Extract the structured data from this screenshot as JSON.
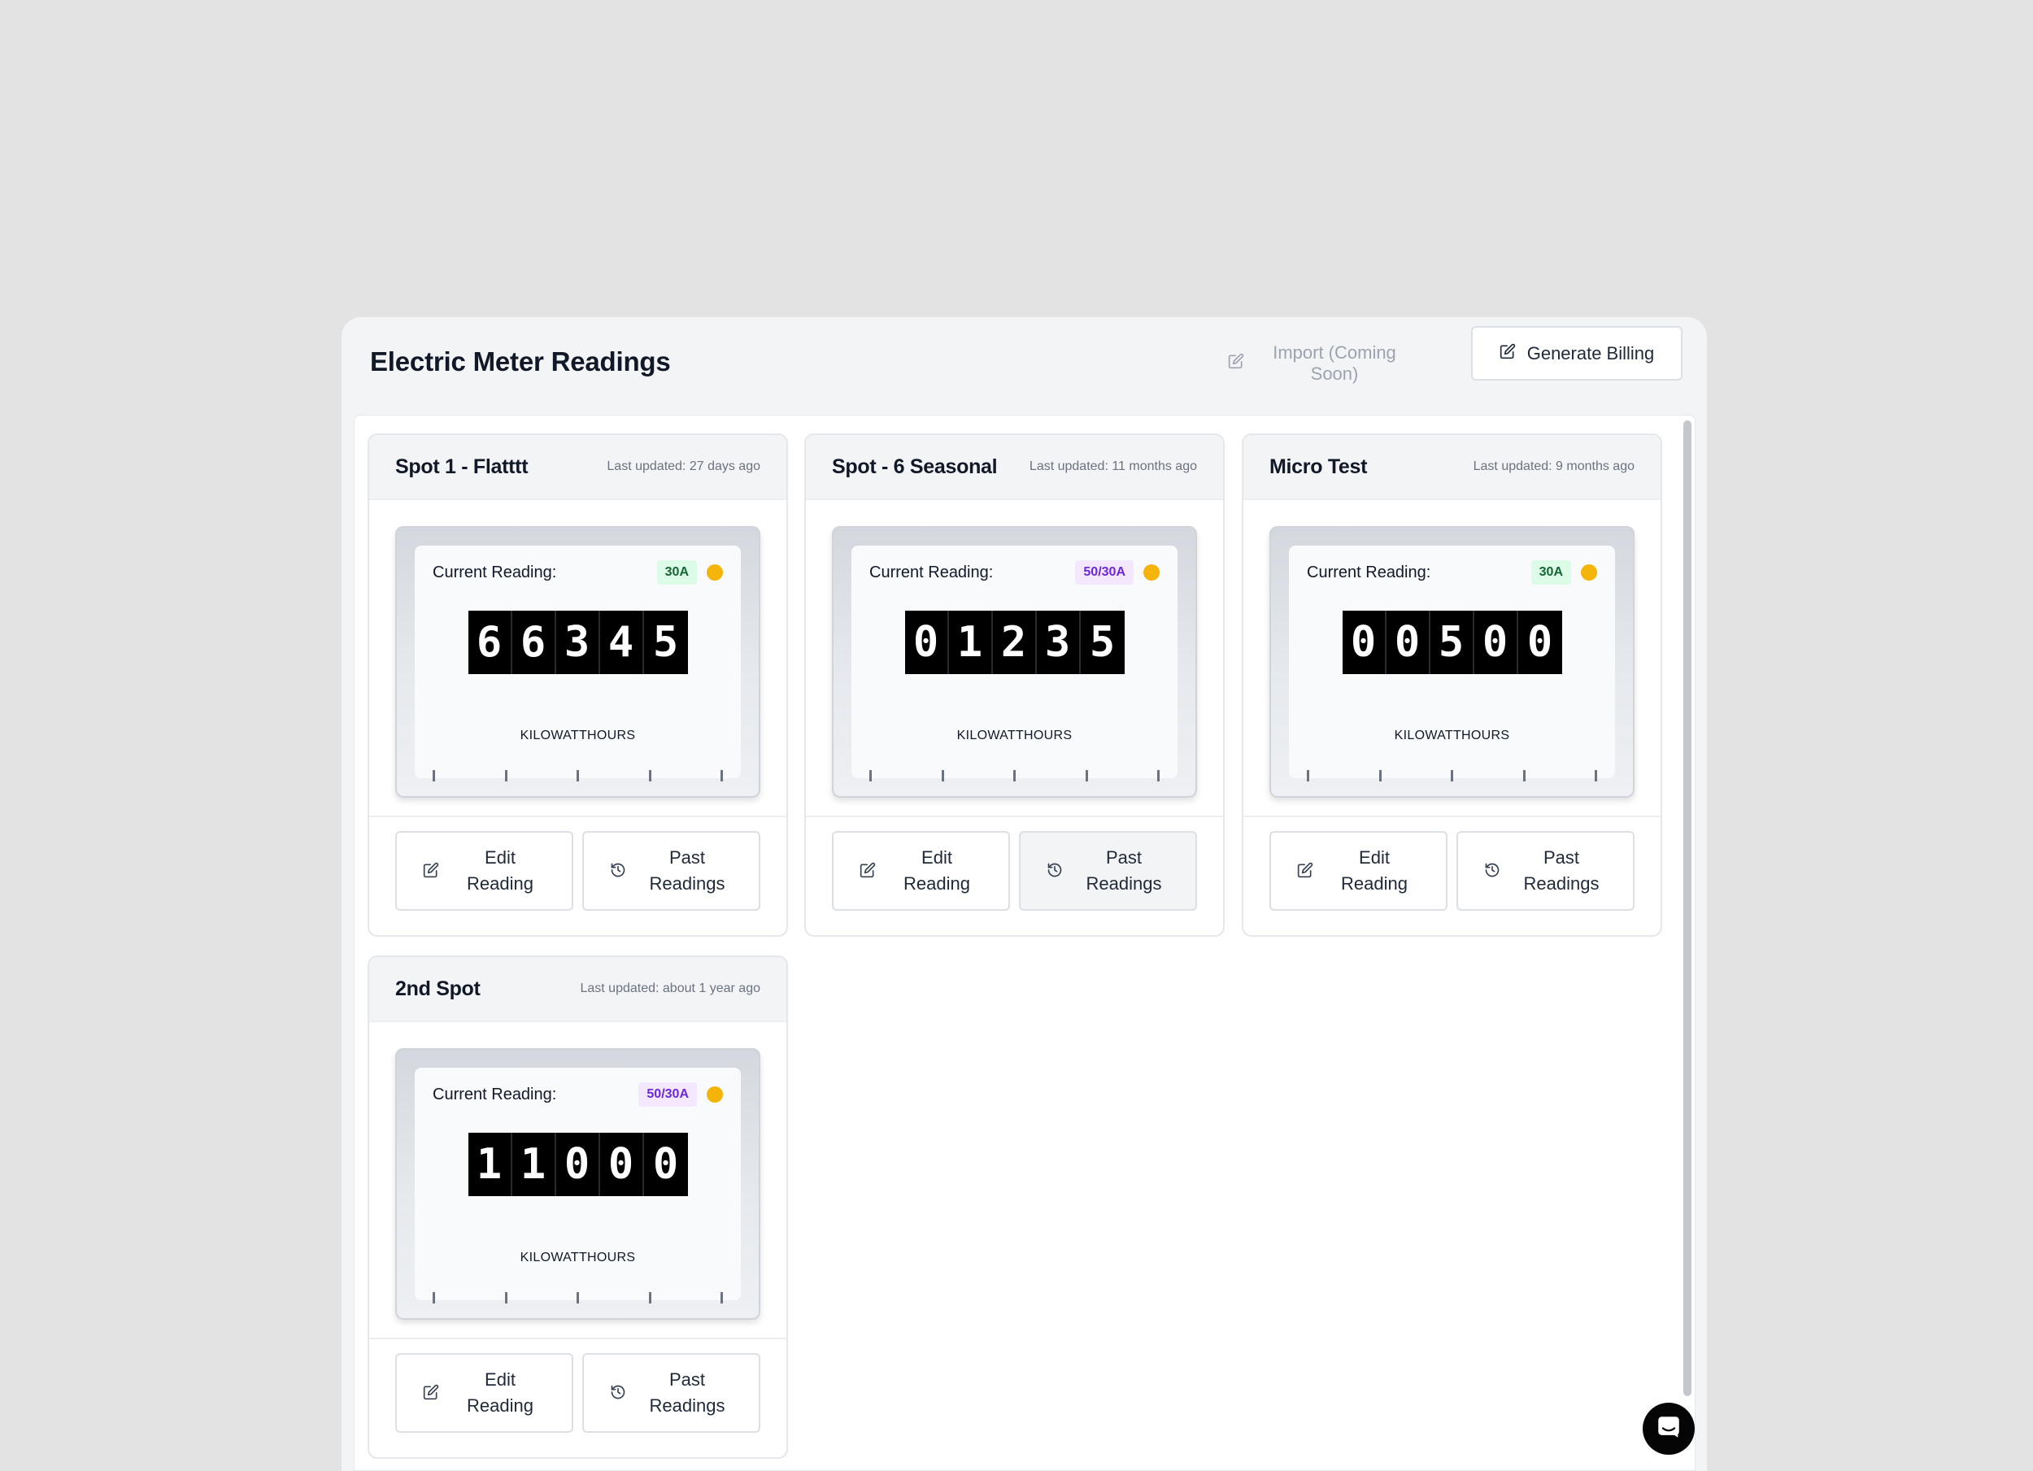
{
  "header": {
    "title": "Electric Meter Readings",
    "import_label": "Import (Coming Soon)",
    "billing_label": "Generate Billing"
  },
  "labels": {
    "current_reading": "Current Reading:",
    "unit": "KILOWATTHOURS",
    "edit_line1": "Edit",
    "edit_line2": "Reading",
    "past_line1": "Past",
    "past_line2": "Readings"
  },
  "cards": [
    {
      "name": "Spot 1 - Flatttt",
      "updated": "Last updated: 27 days ago",
      "amp": "30A",
      "amp_color": "green",
      "digits": [
        "6",
        "6",
        "3",
        "4",
        "5"
      ]
    },
    {
      "name": "Spot - 6 Seasonal",
      "updated": "Last updated: 11 months ago",
      "amp": "50/30A",
      "amp_color": "purple",
      "digits": [
        "0",
        "1",
        "2",
        "3",
        "5"
      ]
    },
    {
      "name": "Micro Test",
      "updated": "Last updated: 9 months ago",
      "amp": "30A",
      "amp_color": "green",
      "digits": [
        "0",
        "0",
        "5",
        "0",
        "0"
      ]
    },
    {
      "name": "2nd Spot",
      "updated": "Last updated: about 1 year ago",
      "amp": "50/30A",
      "amp_color": "purple",
      "digits": [
        "1",
        "1",
        "0",
        "0",
        "0"
      ]
    }
  ],
  "colors": {
    "status_dot": "#f5b40a",
    "badge_green_bg": "#dcfce7",
    "badge_purple_bg": "#f3e8ff"
  },
  "icons": {
    "edit": "edit-icon",
    "history": "history-icon",
    "chat": "chat-icon"
  }
}
